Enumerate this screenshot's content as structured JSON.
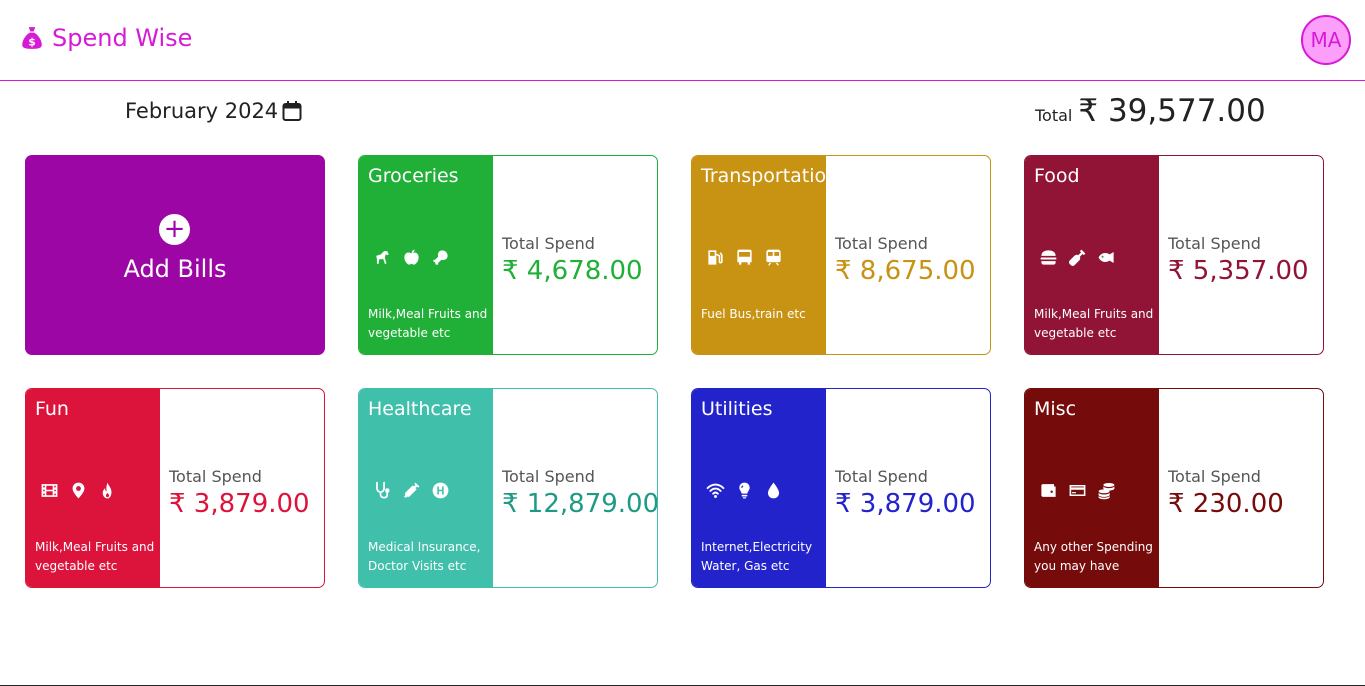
{
  "app": {
    "name": "Spend Wise",
    "avatar_initials": "MA",
    "brand_color": "#d61bd6"
  },
  "header": {
    "month": "February 2024",
    "total_label": "Total",
    "total_value": "₹ 39,577.00"
  },
  "add_card": {
    "label": "Add Bills",
    "color": "#9c06a4"
  },
  "spend_label": "Total Spend",
  "categories": [
    {
      "title": "Groceries",
      "icons": [
        "horse-icon",
        "apple-icon",
        "drumstick-icon"
      ],
      "description": "Milk,Meal Fruits and vegetable etc",
      "value": "₹ 4,678.00",
      "color": "#20b038",
      "value_color": "#20b038"
    },
    {
      "title": "Transportation",
      "icons": [
        "gas-pump-icon",
        "bus-icon",
        "train-icon"
      ],
      "description": "Fuel Bus,train etc",
      "value": "₹ 8,675.00",
      "color": "#c89212",
      "value_color": "#c89212"
    },
    {
      "title": "Food",
      "icons": [
        "burger-icon",
        "wine-bottle-icon",
        "fish-icon"
      ],
      "description": "Milk,Meal Fruits and vegetable etc",
      "value": "₹ 5,357.00",
      "color": "#911436",
      "value_color": "#911436"
    },
    {
      "title": "Fun",
      "icons": [
        "film-icon",
        "location-pin-icon",
        "fire-icon"
      ],
      "description": "Milk,Meal Fruits and vegetable etc",
      "value": "₹ 3,879.00",
      "color": "#dc143c",
      "value_color": "#dc143c"
    },
    {
      "title": "Healthcare",
      "icons": [
        "stethoscope-icon",
        "syringe-icon",
        "hospital-icon"
      ],
      "description": "Medical Insurance, Doctor Visits etc",
      "value": "₹ 12,879.00",
      "color": "#40bfab",
      "value_color": "#1f9a84"
    },
    {
      "title": "Utilities",
      "icons": [
        "wifi-icon",
        "lightbulb-icon",
        "water-drop-icon"
      ],
      "description": "Internet,Electricity Water, Gas etc",
      "value": "₹ 3,879.00",
      "color": "#2323cc",
      "value_color": "#2323cc"
    },
    {
      "title": "Misc",
      "icons": [
        "wallet-icon",
        "credit-card-icon",
        "coins-icon"
      ],
      "description": "Any other Spending you may have",
      "value": "₹ 230.00",
      "color": "#760b0b",
      "value_color": "#760b0b"
    }
  ]
}
